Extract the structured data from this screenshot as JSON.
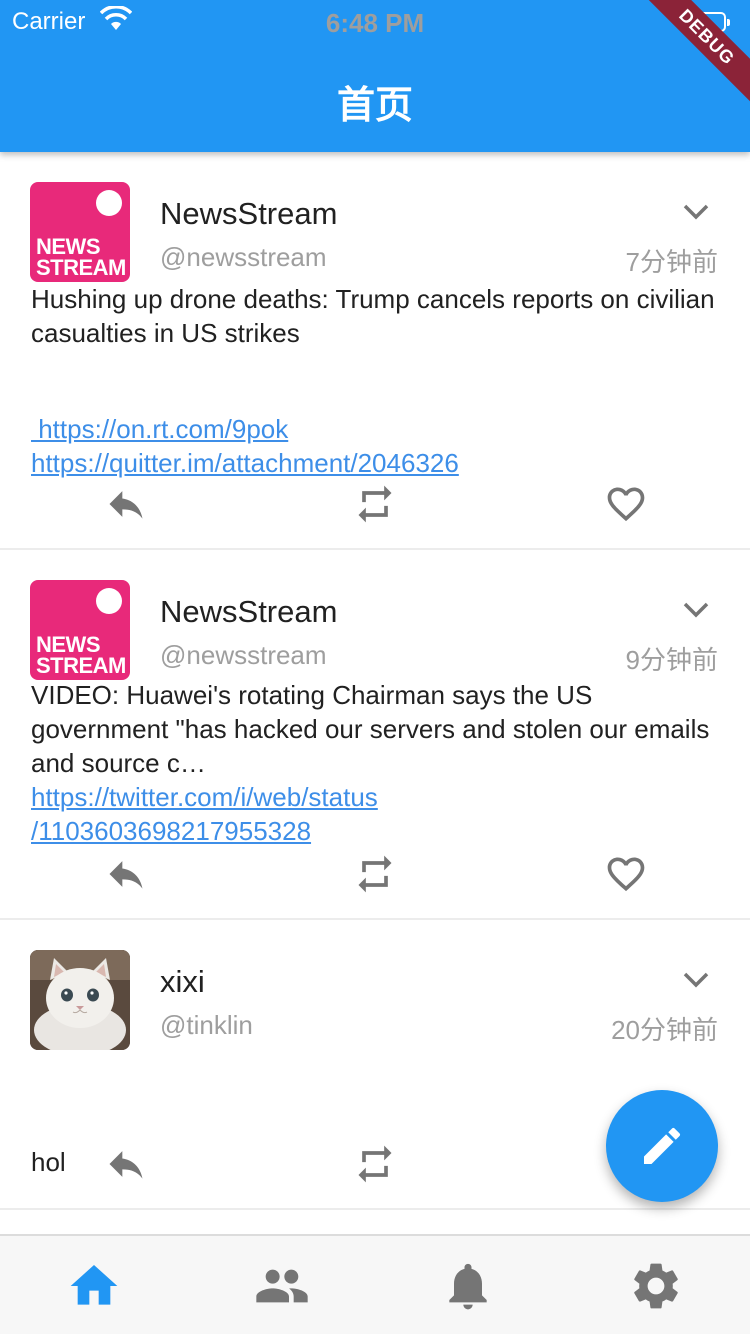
{
  "status_bar": {
    "carrier": "Carrier",
    "time": "6:48 PM"
  },
  "app_bar": {
    "title": "首页"
  },
  "debug_banner": "DEBUG",
  "colors": {
    "primary": "#2196F3",
    "link": "#3d8ee8",
    "news_brand": "#e8297a",
    "icon_gray": "#757575"
  },
  "posts": [
    {
      "name": "NewsStream",
      "handle": "@newsstream",
      "time": "7分钟前",
      "text": "Hushing up drone deaths: Trump cancels reports on civilian casualties in US strikes",
      "links": [
        " https://on.rt.com/9pok",
        "https://quitter.im/attachment/2046326"
      ],
      "avatar_text": [
        "NEWS",
        "STREAM"
      ]
    },
    {
      "name": "NewsStream",
      "handle": "@newsstream",
      "time": "9分钟前",
      "text": "VIDEO: Huawei's rotating Chairman says the US government \"has hacked our servers and stolen our emails and source c…",
      "links": [
        "https://twitter.com/i/web/status",
        "/1103603698217955328"
      ],
      "avatar_text": [
        "NEWS",
        "STREAM"
      ]
    },
    {
      "name": "xixi",
      "handle": "@tinklin",
      "time": "20分钟前",
      "text": "hol",
      "links": [],
      "avatar_text": []
    }
  ],
  "bottom_nav": [
    {
      "icon": "home-icon",
      "active": true
    },
    {
      "icon": "people-icon",
      "active": false
    },
    {
      "icon": "bell-icon",
      "active": false
    },
    {
      "icon": "settings-icon",
      "active": false
    }
  ]
}
